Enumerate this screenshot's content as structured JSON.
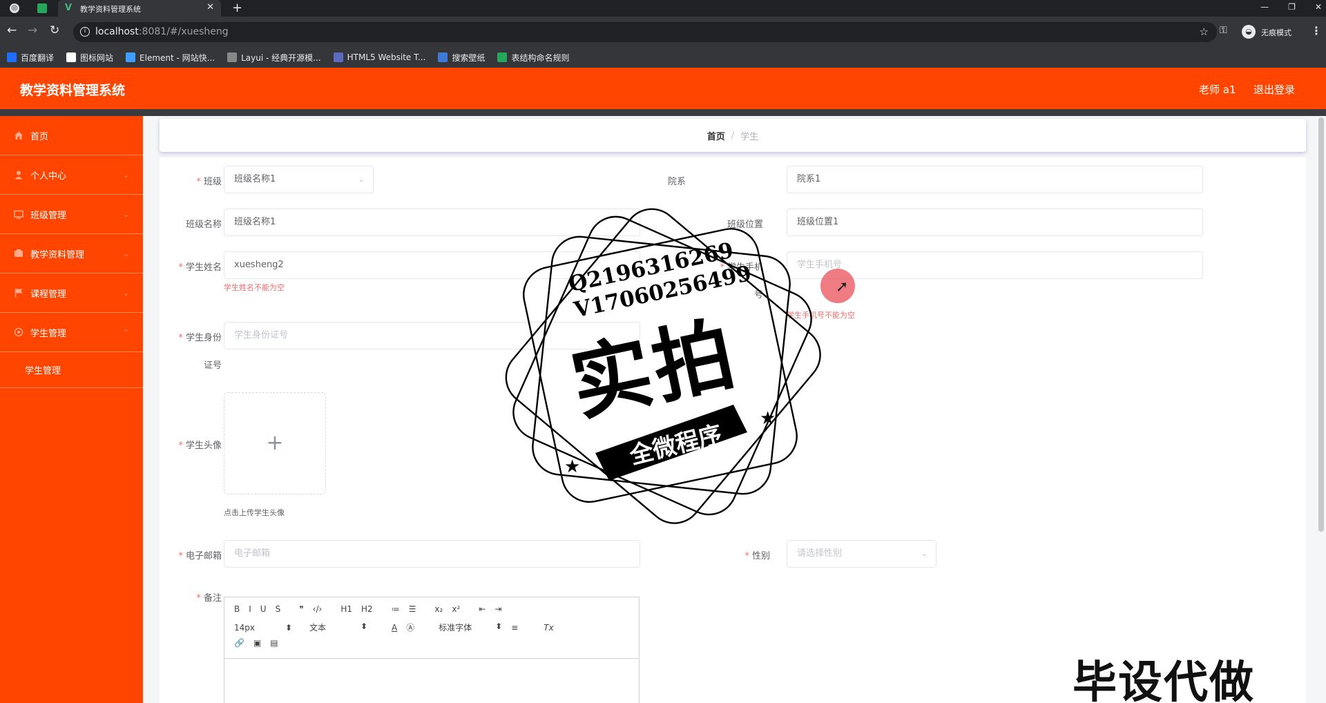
{
  "browser": {
    "tab_title": "教学资料管理系统",
    "tab_close": "✕",
    "new_tab": "+",
    "url_host": "localhost",
    "url_rest": ":8081/#/xuesheng",
    "incognito_label": "无痕模式",
    "bookmarks": [
      {
        "label": "百度翻译",
        "color": "#1e6fff"
      },
      {
        "label": "图标网站",
        "color": "#ffffff"
      },
      {
        "label": "Element - 网站快...",
        "color": "#409eff"
      },
      {
        "label": "Layui - 经典开源模...",
        "color": "#888888"
      },
      {
        "label": "HTML5 Website T...",
        "color": "#5c6bc0"
      },
      {
        "label": "搜索壁纸",
        "color": "#3f7bd6"
      },
      {
        "label": "表结构命名规则",
        "color": "#26a65b"
      }
    ]
  },
  "header": {
    "title": "教学资料管理系统",
    "user": "老师 a1",
    "logout": "退出登录",
    "accent": "#ff4500"
  },
  "sidebar": {
    "items": [
      {
        "label": "首页",
        "icon": "home-icon"
      },
      {
        "label": "个人中心",
        "icon": "user-icon"
      },
      {
        "label": "班级管理",
        "icon": "class-icon"
      },
      {
        "label": "教学资料管理",
        "icon": "material-icon"
      },
      {
        "label": "课程管理",
        "icon": "flag-icon"
      },
      {
        "label": "学生管理",
        "icon": "student-icon"
      }
    ],
    "sub_item": "学生管理"
  },
  "breadcrumb": {
    "home": "首页",
    "separator": "/",
    "current": "学生"
  },
  "form": {
    "class_label": "班级",
    "class_value": "班级名称1",
    "dept_label": "院系",
    "dept_value": "院系1",
    "class_name_label": "班级名称",
    "class_name_value": "班级名称1",
    "class_loc_label": "班级位置",
    "class_loc_value": "班级位置1",
    "student_name_label": "学生姓名",
    "student_name_value": "xuesheng2",
    "student_name_error": "学生姓名不能为空",
    "phone_label_1": "学生手机",
    "phone_label_2": "号",
    "phone_placeholder": "学生手机号",
    "phone_error": "学生手机号不能为空",
    "id_label_1": "学生身份",
    "id_label_2": "证号",
    "id_placeholder": "学生身份证号",
    "avatar_label": "学生头像",
    "avatar_plus": "+",
    "avatar_hint": "点击上传学生头像",
    "email_label": "电子邮箱",
    "email_placeholder": "电子邮箱",
    "gender_label": "性别",
    "gender_placeholder": "请选择性别",
    "remark_label": "备注",
    "required_mark": "*"
  },
  "editor": {
    "row1": [
      "B",
      "I",
      "U",
      "S",
      "❞",
      "‹/›",
      "H1",
      "H2",
      "≔",
      "☰",
      "x₂",
      "x²",
      "⇤",
      "⇥"
    ],
    "font_size": "14px",
    "text_type": "文本",
    "font_family": "标准字体",
    "row2_tools": [
      "A",
      "Ⓐ",
      "≡",
      "Tx"
    ],
    "row3": [
      "🔗",
      "▣",
      "▤"
    ]
  },
  "watermark": {
    "contact_q": "Q2196316269",
    "contact_v": "V17060256499",
    "main": "实拍",
    "sub": "全微程序",
    "corner": "毕设代做"
  }
}
